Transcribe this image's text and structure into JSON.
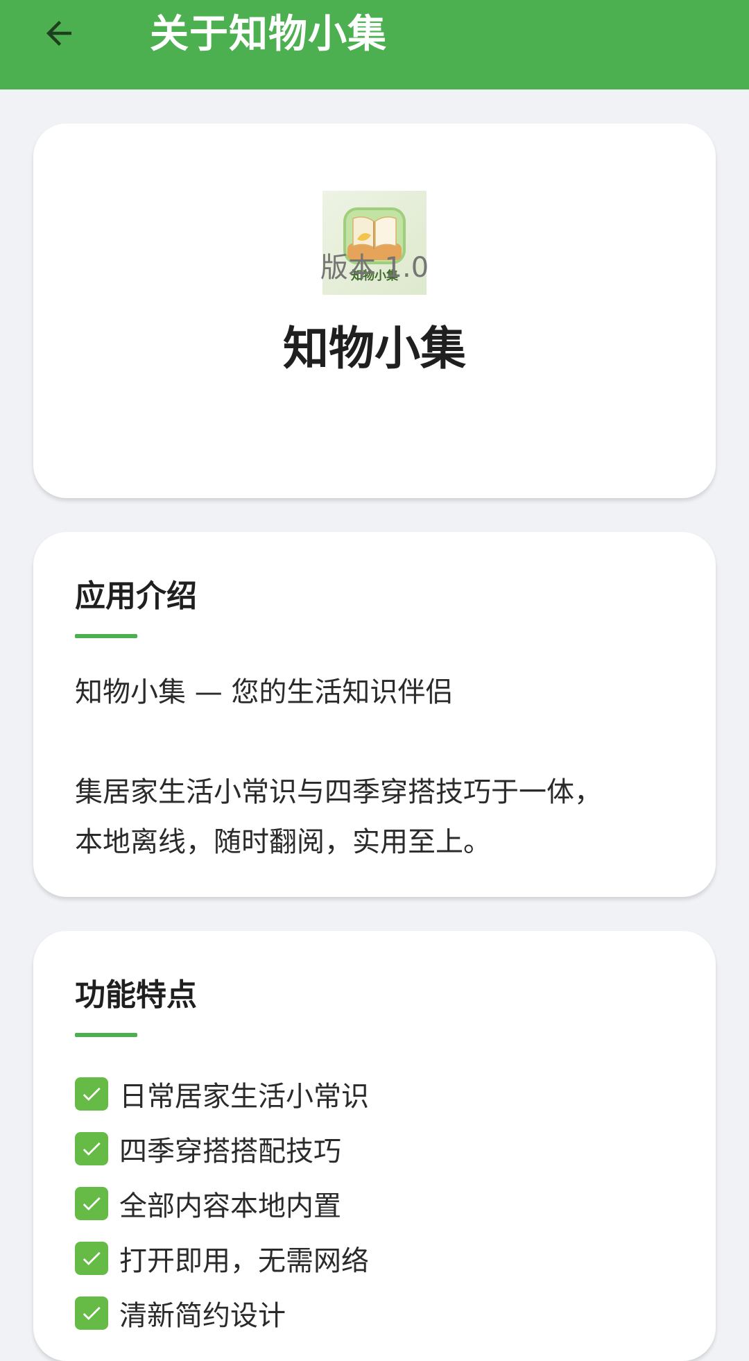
{
  "appbar": {
    "title": "关于知物小集",
    "back_icon": "arrow-left-icon"
  },
  "header": {
    "icon_label": "知物小集",
    "app_name": "知物小集",
    "version": "版本 1.0"
  },
  "intro": {
    "title": "应用介绍",
    "line1": "知物小集 — 您的生活知识伴侣",
    "line2": "集居家生活小常识与四季穿搭技巧于一体，",
    "line3": "本地离线，随时翻阅，实用至上。"
  },
  "features": {
    "title": "功能特点",
    "items": [
      {
        "label": "日常居家生活小常识",
        "icon": "check-icon"
      },
      {
        "label": "四季穿搭搭配技巧",
        "icon": "check-icon"
      },
      {
        "label": "全部内容本地内置",
        "icon": "check-icon"
      },
      {
        "label": "打开即用，无需网络",
        "icon": "check-icon"
      },
      {
        "label": "清新简约设计",
        "icon": "check-icon"
      }
    ]
  },
  "colors": {
    "primary": "#4caf50",
    "background": "#f1f2f6",
    "card": "#ffffff",
    "check": "#66bb46",
    "text_secondary": "#757575"
  }
}
